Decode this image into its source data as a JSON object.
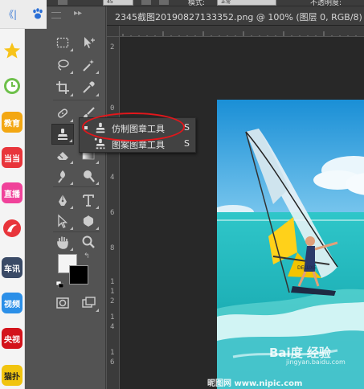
{
  "browser": {
    "collapse_label": "《|",
    "sidebar_items": [
      {
        "label": "",
        "icon": "star-icon",
        "color": "#f7c31a"
      },
      {
        "label": "",
        "icon": "clock-icon",
        "color": "#6ec04b"
      },
      {
        "label": "教育",
        "icon": "education-icon",
        "color": "#f3a712"
      },
      {
        "label": "当当",
        "icon": "dangdang-icon",
        "color": "#e8353b"
      },
      {
        "label": "直播",
        "icon": "live-icon",
        "color": "#f0429a"
      },
      {
        "label": "",
        "icon": "phoenix-icon",
        "color": "#e8353b"
      },
      {
        "label": "车讯",
        "icon": "car-news-icon",
        "color": "#3a4a66"
      },
      {
        "label": "视频",
        "icon": "video-icon",
        "color": "#2b8fe8"
      },
      {
        "label": "央视",
        "icon": "cctv-icon",
        "color": "#d3131b"
      },
      {
        "label": "猫扑",
        "icon": "maopu-icon",
        "color": "#f1c40f"
      }
    ]
  },
  "options_bar": {
    "size_value": "45",
    "mode_label": "模式:",
    "mode_value": "正常",
    "right_label": "不透明度:"
  },
  "document": {
    "tab_title": "2345截图20190827133352.png @ 100% (图层 0, RGB/8)",
    "vruler_ticks": [
      "2",
      "0",
      "2",
      "4",
      "6",
      "8",
      "1",
      "1",
      "2",
      "1",
      "4",
      "1",
      "6"
    ]
  },
  "toolbar": {
    "tools": [
      {
        "icon": "rect-marquee-icon"
      },
      {
        "icon": "move-icon"
      },
      {
        "icon": "lasso-icon"
      },
      {
        "icon": "magic-wand-icon"
      },
      {
        "icon": "crop-icon"
      },
      {
        "icon": "eyedropper-icon"
      },
      {
        "icon": "healing-brush-icon"
      },
      {
        "icon": "brush-icon"
      },
      {
        "icon": "clone-stamp-icon"
      },
      {
        "icon": "history-brush-icon"
      },
      {
        "icon": "eraser-icon"
      },
      {
        "icon": "gradient-icon"
      },
      {
        "icon": "smudge-icon"
      },
      {
        "icon": "dodge-icon"
      },
      {
        "icon": "pen-icon"
      },
      {
        "icon": "type-icon"
      },
      {
        "icon": "path-select-icon"
      },
      {
        "icon": "custom-shape-icon"
      },
      {
        "icon": "hand-icon"
      },
      {
        "icon": "zoom-icon"
      }
    ],
    "foreground_color": "#f4f4f4",
    "background_color": "#000000"
  },
  "flyout": {
    "items": [
      {
        "label": "仿制图章工具",
        "shortcut": "S",
        "icon": "clone-stamp-icon",
        "selected": true
      },
      {
        "label": "图案图章工具",
        "shortcut": "S",
        "icon": "pattern-stamp-icon",
        "selected": false
      }
    ],
    "highlight_color": "#e3161b"
  },
  "watermarks": {
    "baidu": "Bai度 经验",
    "baidu_url": "jingyan.baidu.com",
    "nipic": "昵图网 www.nipic.com"
  }
}
